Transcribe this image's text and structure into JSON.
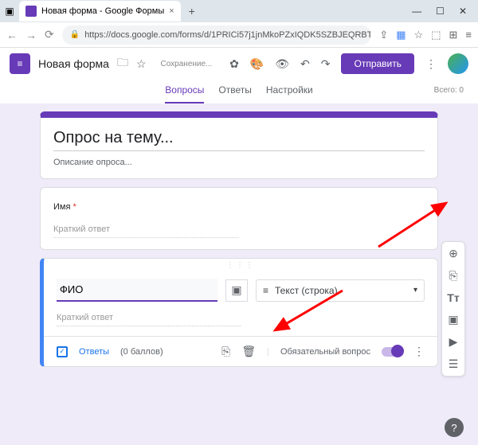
{
  "browser": {
    "tab_title": "Новая форма - Google Формы",
    "url": "https://docs.google.com/forms/d/1PRICi57j1jnMkoPZxIQDK5SZBJEQRBTO"
  },
  "header": {
    "form_name": "Новая форма",
    "saving": "Сохранение...",
    "send": "Отправить"
  },
  "tabs": {
    "questions": "Вопросы",
    "answers": "Ответы",
    "settings": "Настройки",
    "total": "Всего: 0"
  },
  "title_card": {
    "title": "Опрос на тему...",
    "description": "Описание опроса..."
  },
  "q1": {
    "label": "Имя",
    "placeholder": "Краткий ответ"
  },
  "q2": {
    "title": "ФИО",
    "placeholder": "Краткий ответ",
    "type": "Текст (строка)",
    "answers_label": "Ответы",
    "points": "(0 баллов)",
    "required": "Обязательный вопрос"
  }
}
